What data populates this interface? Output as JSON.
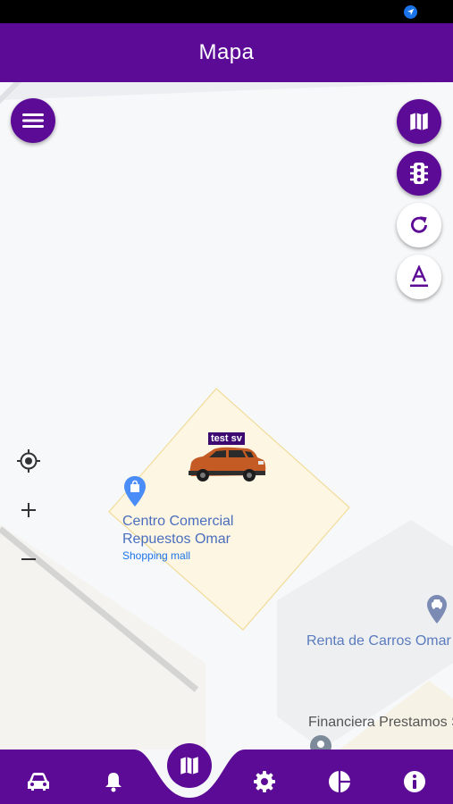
{
  "appbar": {
    "title": "Mapa"
  },
  "map": {
    "car_label": "test sv",
    "poi_mall": {
      "name_line1": "Centro Comercial",
      "name_line2": "Repuestos Omar",
      "category": "Shopping mall"
    },
    "poi_rental": {
      "name": "Renta de Carros Omar"
    },
    "poi_finance": {
      "name": "Financiera Prestamos S"
    }
  },
  "colors": {
    "primary": "#5c0b97",
    "poi_text": "#4a6ebd",
    "geofence": "#fdf6e3"
  },
  "icons": {
    "fabs": [
      "menu-icon",
      "map-icon",
      "traffic-light-icon",
      "refresh-icon",
      "text-format-icon"
    ],
    "map_controls": [
      "my-location-icon",
      "zoom-in-icon",
      "zoom-out-icon"
    ],
    "bottom_nav": [
      "car-icon",
      "bell-icon",
      "map-icon",
      "gear-icon",
      "pie-chart-icon",
      "info-icon"
    ]
  }
}
